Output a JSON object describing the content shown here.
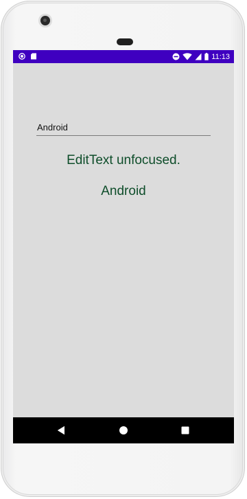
{
  "status_bar": {
    "time": "11:13",
    "icons": [
      "record-icon",
      "sd-card-icon",
      "do-not-disturb-icon",
      "wifi-icon",
      "signal-icon",
      "battery-icon"
    ],
    "color": "#3f00c0"
  },
  "main": {
    "edit_text_value": "Android",
    "status_message": "EditText unfocused.",
    "echo_value": "Android",
    "background": "#dcdcdc",
    "text_color": "#0e4d2a"
  },
  "nav_bar": {
    "buttons": [
      "back-icon",
      "home-icon",
      "recents-icon"
    ]
  }
}
